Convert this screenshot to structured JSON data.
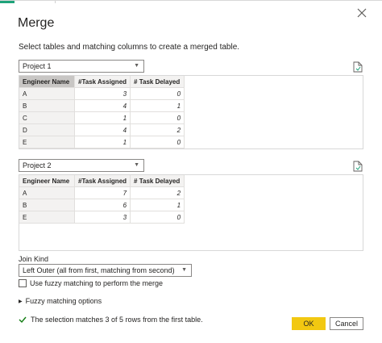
{
  "dialog": {
    "title": "Merge",
    "subtitle": "Select tables and matching columns to create a merged table."
  },
  "table1": {
    "selected": "Project 1",
    "columns": [
      "Engineer Name",
      "#Task Assigned",
      "# Task Delayed"
    ],
    "rows": [
      [
        "A",
        "3",
        "0"
      ],
      [
        "B",
        "4",
        "1"
      ],
      [
        "C",
        "1",
        "0"
      ],
      [
        "D",
        "4",
        "2"
      ],
      [
        "E",
        "1",
        "0"
      ]
    ]
  },
  "table2": {
    "selected": "Project 2",
    "columns": [
      "Engineer Name",
      "#Task Assigned",
      "# Task Delayed"
    ],
    "rows": [
      [
        "A",
        "7",
        "2"
      ],
      [
        "B",
        "6",
        "1"
      ],
      [
        "E",
        "3",
        "0"
      ]
    ]
  },
  "join": {
    "label": "Join Kind",
    "selected": "Left Outer (all from first, matching from second)"
  },
  "fuzzy": {
    "checkbox_label": "Use fuzzy matching to perform the merge",
    "options_label": "Fuzzy matching options"
  },
  "status": {
    "message": "The selection matches 3 of 5 rows from the first table."
  },
  "buttons": {
    "ok": "OK",
    "cancel": "Cancel"
  },
  "colors": {
    "ok_button": "#f2c811",
    "check": "#107c10",
    "selected_header": "#c8c6c4"
  },
  "icons": {
    "close": "close-icon",
    "file": "file-preview-icon",
    "check": "check-icon",
    "chevron": "chevron-down-icon",
    "expand": "triangle-right-icon"
  }
}
